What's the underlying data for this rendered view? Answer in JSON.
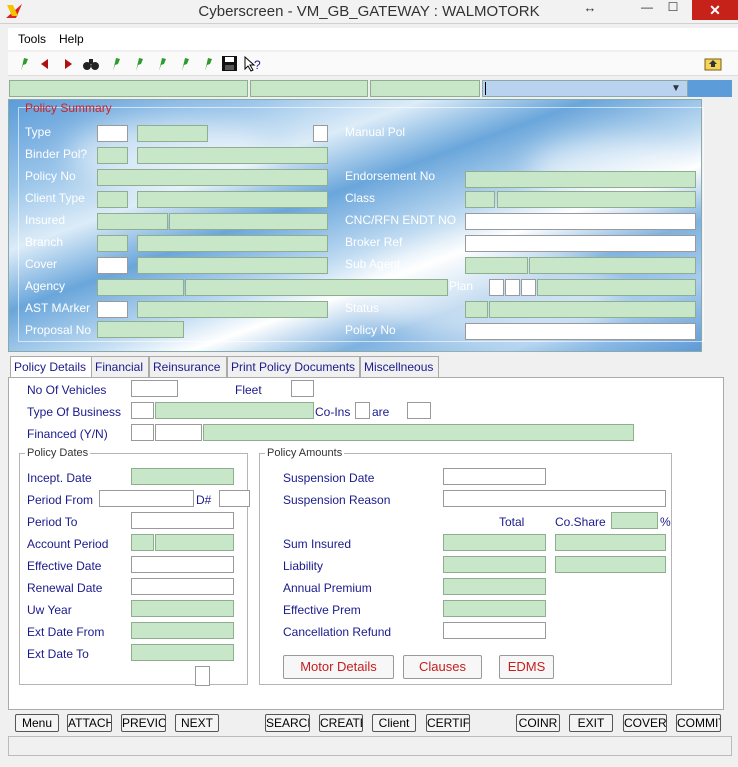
{
  "window": {
    "title": "Cyberscreen - VM_GB_GATEWAY : WALMOTORK",
    "minimize": "—",
    "maximize": "☐",
    "close": "✕",
    "resize": "↔"
  },
  "menu": {
    "tools": "Tools",
    "help": "Help"
  },
  "summary": {
    "legend": "Policy Summary",
    "type": "Type",
    "manual_pol": "Manual Pol",
    "binder_pol": "Binder Pol?",
    "policy_no": "Policy No",
    "endorsement_no": "Endorsement No",
    "client_type": "Client Type",
    "class": "Class",
    "insured": "Insured",
    "cnc_rfn": "CNC/RFN ENDT NO",
    "branch": "Branch",
    "broker_ref": "Broker Ref",
    "cover": "Cover",
    "sub_agent": "Sub Agent",
    "agency": "Agency",
    "plan": "Plan",
    "ast_marker": "AST MArker",
    "status": "Status",
    "proposal_no": "Proposal No",
    "policy_no2": "Policy No"
  },
  "tabs": [
    "Policy Details",
    "Financial",
    "Reinsurance",
    "Print Policy Documents",
    "Miscellneous"
  ],
  "details": {
    "no_vehicles": "No Of Vehicles",
    "fleet": "Fleet",
    "type_business": "Type Of Business",
    "co_ins": "Co-Ins",
    "are": "are",
    "financed": "Financed (Y/N)"
  },
  "dates": {
    "legend": "Policy Dates",
    "incept": "Incept. Date",
    "period_from": "Period From",
    "d_hash": "D#",
    "period_to": "Period To",
    "account_period": "Account Period",
    "effective": "Effective Date",
    "renewal": "Renewal Date",
    "uw_year": "Uw Year",
    "ext_from": "Ext Date From",
    "ext_to": "Ext Date To"
  },
  "amounts": {
    "legend": "Policy Amounts",
    "suspension_date": "Suspension Date",
    "suspension_reason": "Suspension Reason",
    "total": "Total",
    "co_share": "Co.Share",
    "pct": "%",
    "sum_insured": "Sum Insured",
    "liability": "Liability",
    "annual_premium": "Annual Premium",
    "effective_prem": "Effective Prem",
    "cancellation_refund": "Cancellation Refund",
    "motor_details": "Motor Details",
    "clauses": "Clauses",
    "edms": "EDMS"
  },
  "bottom": [
    "Menu",
    "ATTACH",
    "PREVIC",
    "NEXT",
    "SEARCH",
    "CREATE",
    "Client",
    "CERTIF",
    "COINR",
    "EXIT",
    "COVER",
    "COMMIT"
  ],
  "icons": [
    "app-logo-icon",
    "flag-icon",
    "prev-arrow-icon",
    "next-arrow-icon",
    "binoculars-icon",
    "pen-icon",
    "save-icon",
    "help-icon",
    "folder-up-icon",
    "dropdown-arrow-icon"
  ]
}
